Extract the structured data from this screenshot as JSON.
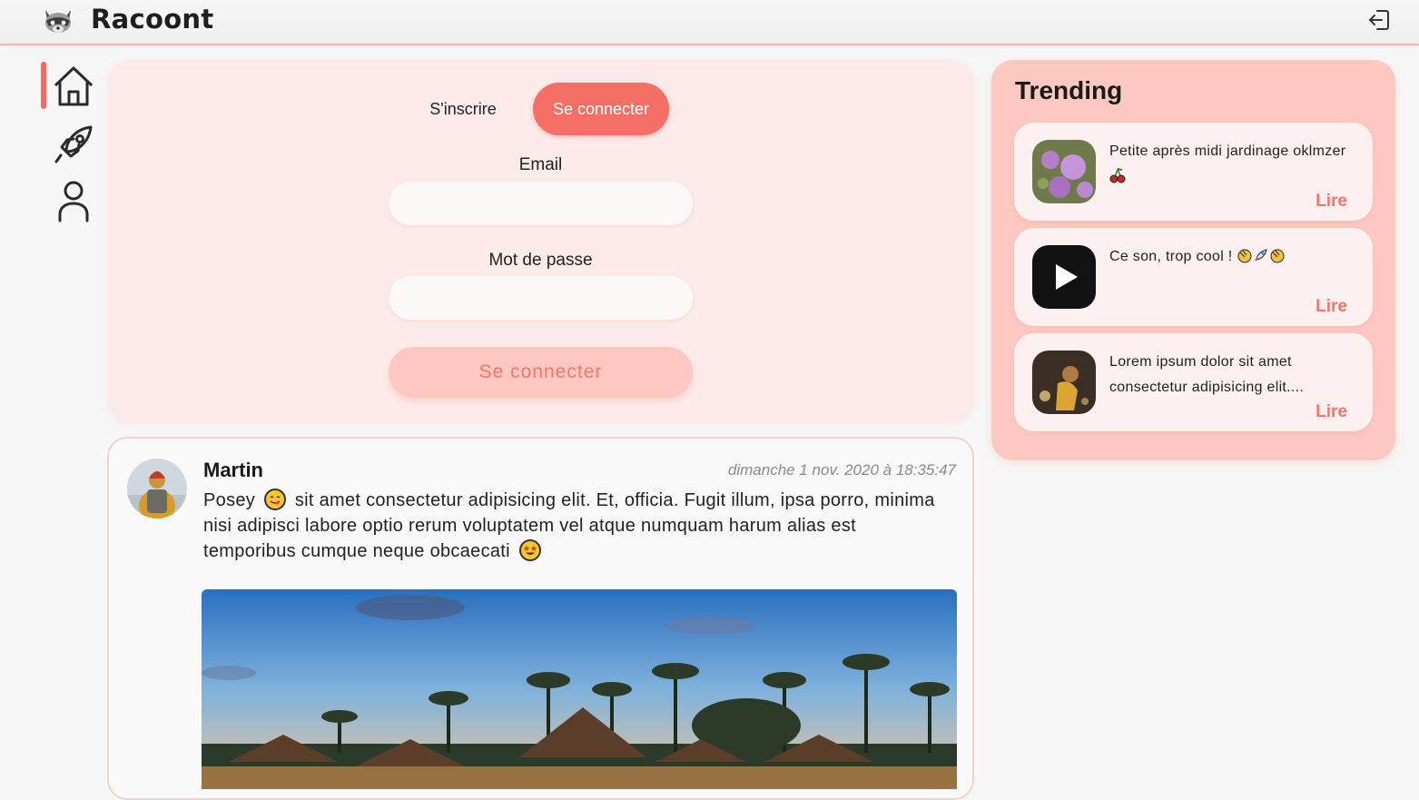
{
  "app": {
    "title": "Racoont"
  },
  "header": {
    "logout_icon": "logout-icon",
    "logo_icon": "raccoon-logo-icon"
  },
  "nav": [
    {
      "icon": "home-icon",
      "active": true
    },
    {
      "icon": "rocket-icon",
      "active": false
    },
    {
      "icon": "user-icon",
      "active": false
    }
  ],
  "auth": {
    "tab_signup": "S'inscrire",
    "tab_login": "Se connecter",
    "email_label": "Email",
    "password_label": "Mot de passe",
    "email_value": "",
    "password_value": "",
    "submit_label": "Se connecter"
  },
  "post": {
    "author": "Martin",
    "date": "dimanche 1 nov. 2020 à 18:35:47",
    "text_part1": "Posey",
    "text_part2": "sit amet consectetur adipisicing elit. Et, officia. Fugit illum, ipsa porro, minima nisi adipisci labore optio rerum voluptatem vel atque numquam harum alias est temporibus cumque neque obcaecati",
    "emoji_1": "yum-emoji",
    "emoji_2": "star-struck-emoji"
  },
  "trending": {
    "title": "Trending",
    "items": [
      {
        "text": "Petite après midi jardinage oklmzer",
        "icon": "cherries-icon",
        "read_label": "Lire"
      },
      {
        "text": "Ce son, trop cool !",
        "icon": "clap-rocket-clap-icons",
        "read_label": "Lire"
      },
      {
        "text": "Lorem ipsum dolor sit amet consectetur adipisicing elit....",
        "read_label": "Lire"
      }
    ]
  },
  "colors": {
    "accent": "#f66f66",
    "panel": "#fdebeb",
    "trending_bg": "#fcc8c0"
  }
}
